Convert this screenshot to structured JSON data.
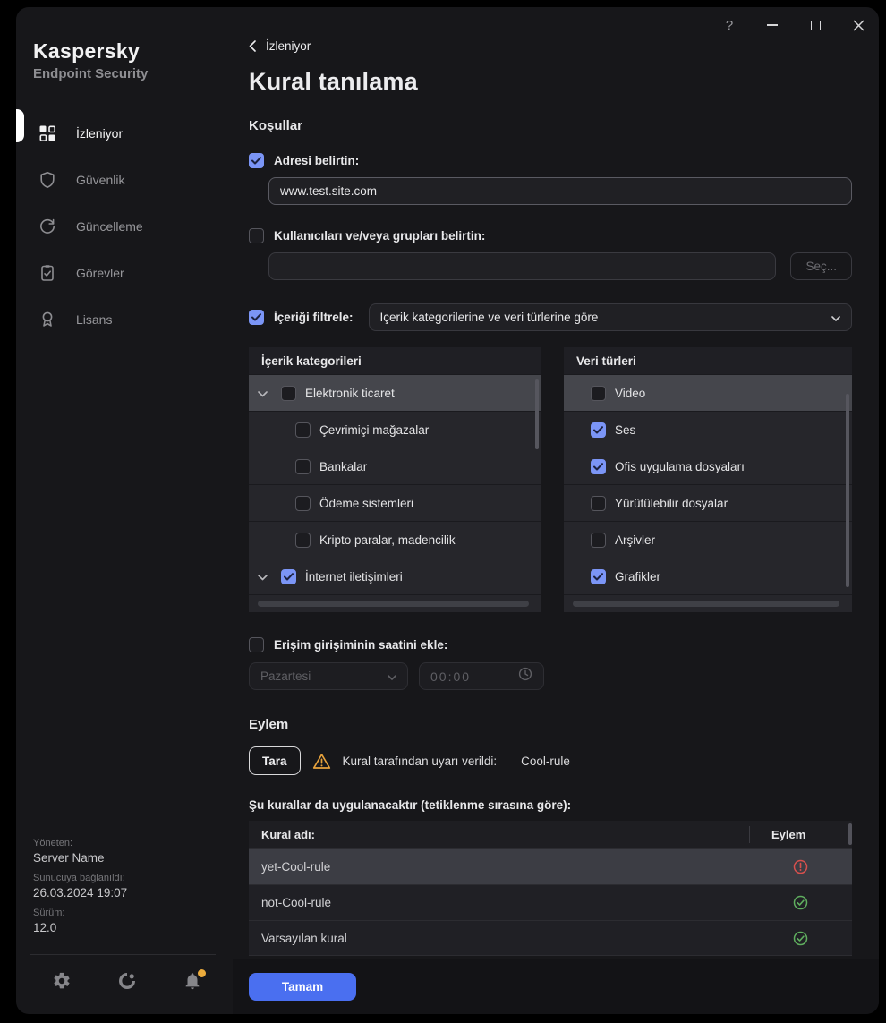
{
  "titlebar": {
    "help": "?"
  },
  "sidebar": {
    "brand": {
      "name": "Kaspersky",
      "product": "Endpoint Security"
    },
    "items": [
      {
        "label": "İzleniyor",
        "active": true
      },
      {
        "label": "Güvenlik",
        "active": false
      },
      {
        "label": "Güncelleme",
        "active": false
      },
      {
        "label": "Görevler",
        "active": false
      },
      {
        "label": "Lisans",
        "active": false
      }
    ],
    "footer": {
      "managed_label": "Yöneten:",
      "managed_value": "Server Name",
      "connected_label": "Sunucuya bağlanıldı:",
      "connected_value": "26.03.2024 19:07",
      "version_label": "Sürüm:",
      "version_value": "12.0"
    }
  },
  "header": {
    "back": "İzleniyor",
    "title": "Kural tanılama"
  },
  "conditions": {
    "heading": "Koşullar",
    "address": {
      "label": "Adresi belirtin:",
      "checked": true,
      "value": "www.test.site.com"
    },
    "users": {
      "label": "Kullanıcıları ve/veya grupları belirtin:",
      "checked": false,
      "value": "",
      "select_button": "Seç..."
    },
    "content_filter": {
      "label": "İçeriği filtrele:",
      "checked": true,
      "selected_option": "İçerik kategorilerine ve veri türlerine göre"
    },
    "categories_panel": {
      "title": "İçerik kategorileri",
      "items": [
        {
          "label": "Elektronik ticaret",
          "checked": false,
          "expandable": true,
          "level": 0,
          "selected": true
        },
        {
          "label": "Çevrimiçi mağazalar",
          "checked": false,
          "level": 1
        },
        {
          "label": "Bankalar",
          "checked": false,
          "level": 1
        },
        {
          "label": "Ödeme sistemleri",
          "checked": false,
          "level": 1
        },
        {
          "label": "Kripto paralar, madencilik",
          "checked": false,
          "level": 1
        },
        {
          "label": "İnternet iletişimleri",
          "checked": true,
          "expandable": true,
          "level": 0
        }
      ]
    },
    "datatypes_panel": {
      "title": "Veri türleri",
      "items": [
        {
          "label": "Video",
          "checked": false,
          "selected": true
        },
        {
          "label": "Ses",
          "checked": true
        },
        {
          "label": "Ofis uygulama dosyaları",
          "checked": true
        },
        {
          "label": "Yürütülebilir dosyalar",
          "checked": false
        },
        {
          "label": "Arşivler",
          "checked": false
        },
        {
          "label": "Grafikler",
          "checked": true
        }
      ]
    },
    "time": {
      "label": "Erişim girişiminin saatini ekle:",
      "checked": false,
      "day": "Pazartesi",
      "time": "00:00"
    }
  },
  "action": {
    "heading": "Eylem",
    "test_button": "Tara",
    "warning_text": "Kural tarafından uyarı verildi:",
    "triggered_rule": "Cool-rule",
    "rules_label": "Şu kurallar da uygulanacaktır (tetiklenme sırasına göre):",
    "table": {
      "columns": [
        "Kural adı:",
        "Eylem"
      ],
      "rows": [
        {
          "name": "yet-Cool-rule",
          "status": "warning",
          "selected": true
        },
        {
          "name": "not-Cool-rule",
          "status": "ok",
          "selected": false
        },
        {
          "name": "Varsayılan kural",
          "status": "ok",
          "selected": false
        }
      ]
    }
  },
  "footer": {
    "ok_button": "Tamam"
  },
  "colors": {
    "accent": "#4a6ff0",
    "checkbox": "#7b95f6",
    "warning": "#e8a33d",
    "error": "#d8504d",
    "success": "#5fae5f"
  }
}
